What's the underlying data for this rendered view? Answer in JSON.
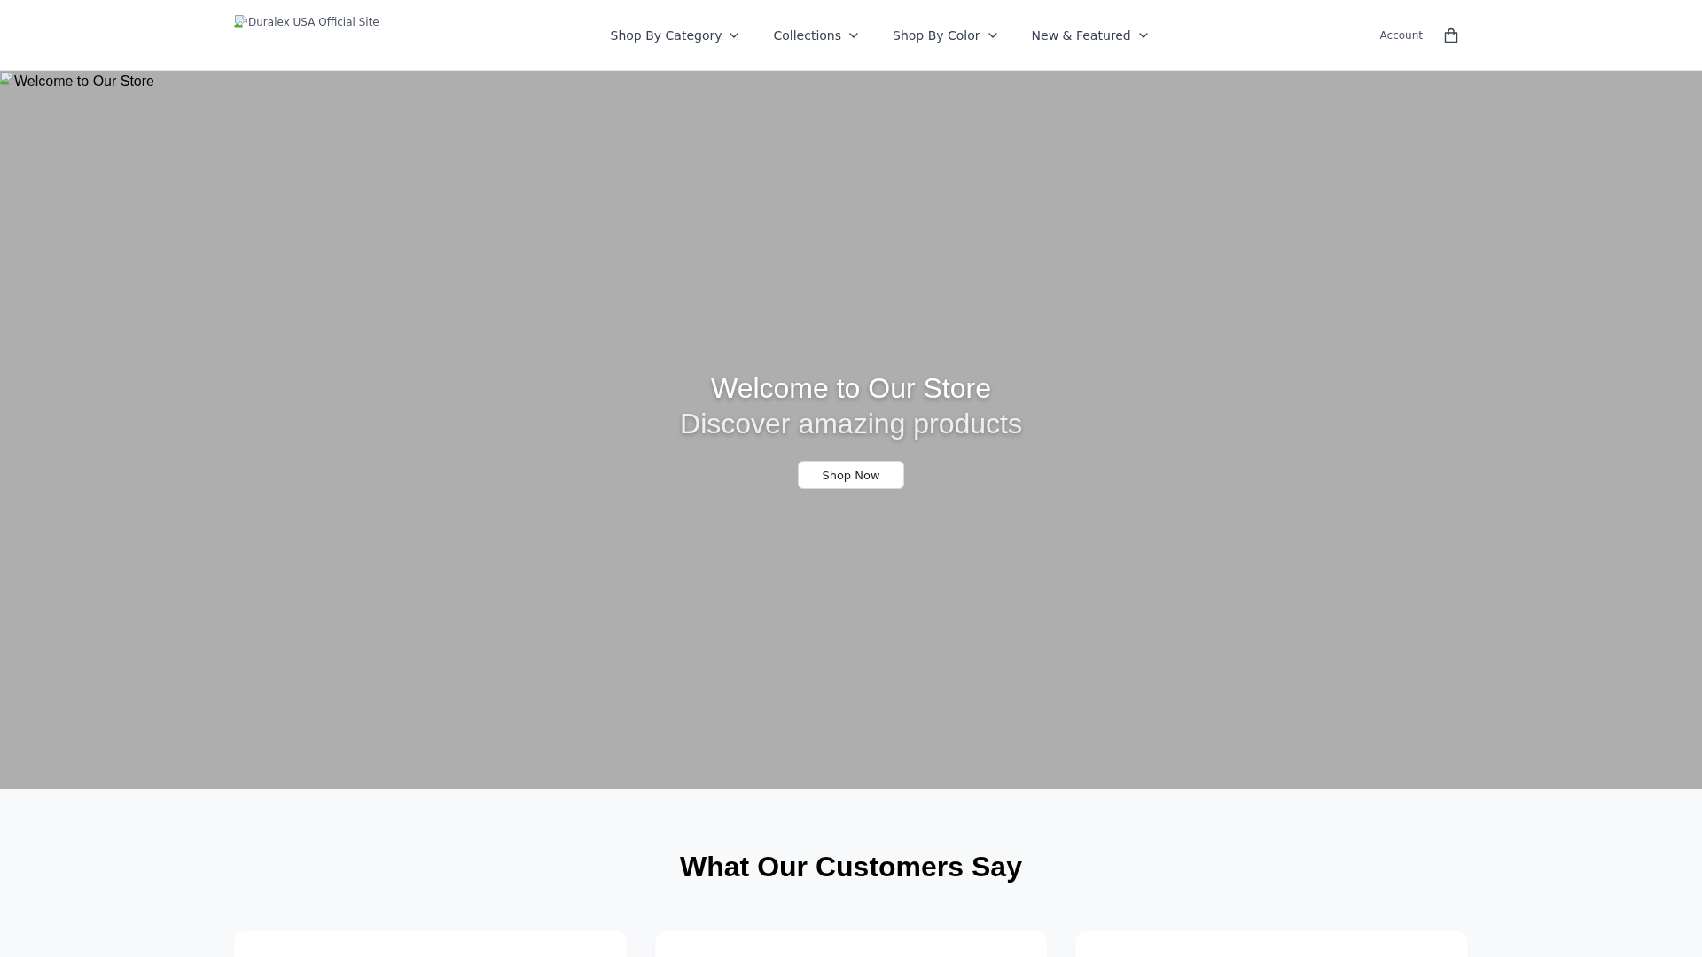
{
  "header": {
    "logo": {
      "alt_text": "Duralex USA Official Site"
    },
    "nav": [
      {
        "label": "Shop By Category",
        "dropdown": true
      },
      {
        "label": "Collections",
        "dropdown": true
      },
      {
        "label": "Shop By Color",
        "dropdown": true
      },
      {
        "label": "New & Featured",
        "dropdown": true
      }
    ],
    "account": {
      "label": "Account"
    }
  },
  "hero": {
    "image_alt": "Welcome to Our Store",
    "title": "Welcome to Our Store",
    "subtitle": "Discover amazing products",
    "button": "Shop Now"
  },
  "testimonials": {
    "title": "What Our Customers Say"
  }
}
